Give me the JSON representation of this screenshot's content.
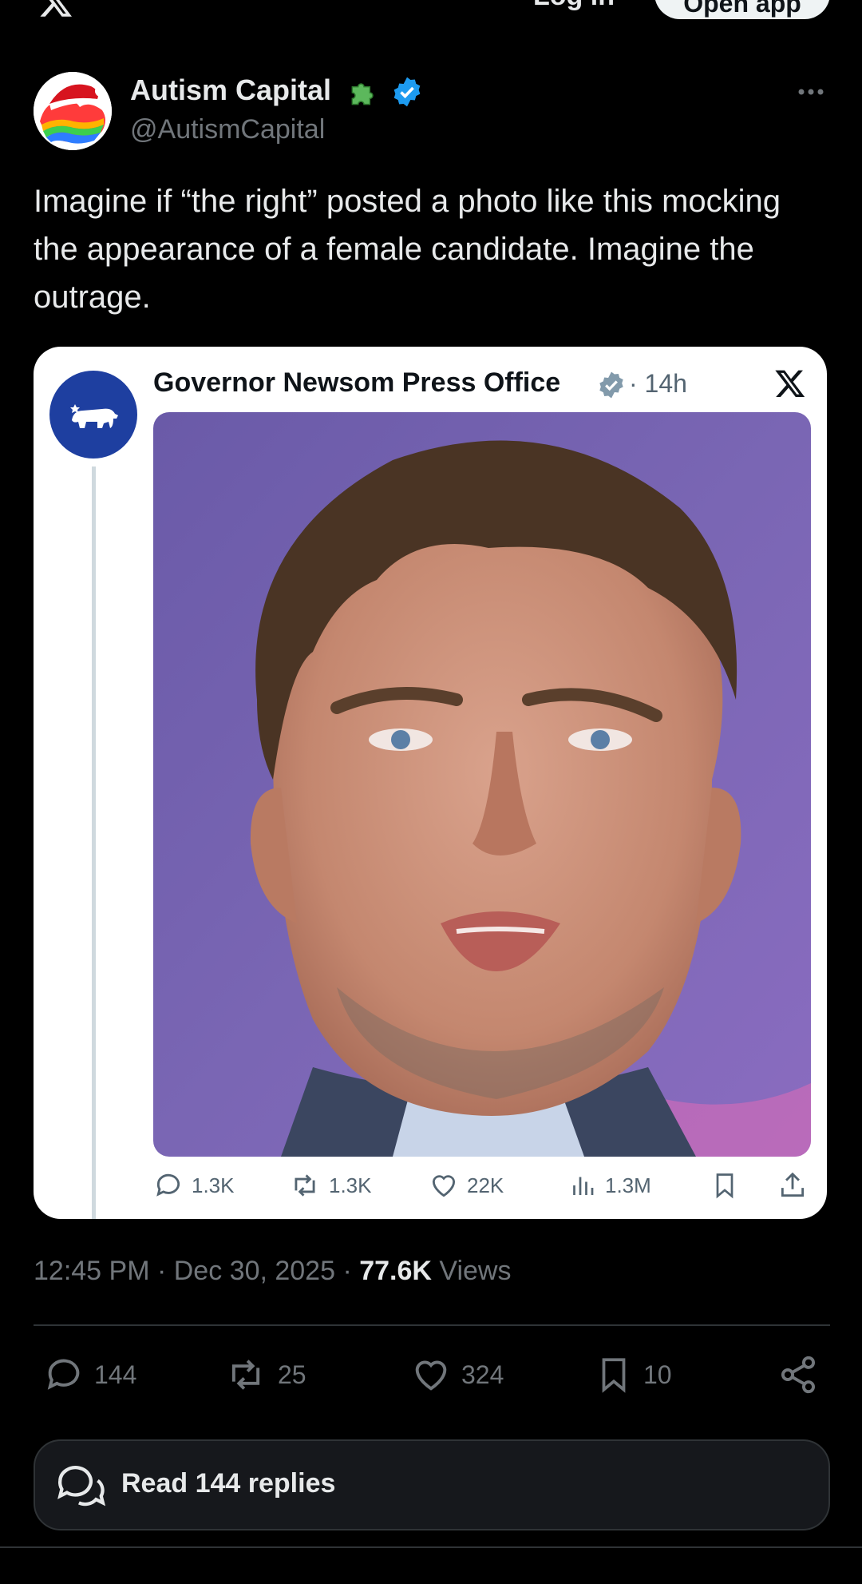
{
  "topbar": {
    "login_label": "Log in",
    "open_app_label": "Open app"
  },
  "post": {
    "author": "Autism Capital",
    "handle": "@AutismCapital",
    "text": "Imagine if “the right” posted a photo like this mocking the appearance of a female candidate. Imagine the outrage.",
    "timestamp": "12:45 PM · Dec 30, 2025 · ",
    "views_count": "77.6K",
    "views_label": " Views"
  },
  "quote": {
    "author": "Governor Newsom Press Office",
    "time": "· 14h",
    "replies": "1.3K",
    "reposts": "1.3K",
    "likes": "22K",
    "views": "1.3M"
  },
  "actions": {
    "replies": "144",
    "reposts": "25",
    "likes": "324",
    "bookmarks": "10"
  },
  "read_replies": {
    "label": "Read 144 replies"
  },
  "colors": {
    "background": "#000000",
    "verified_blue": "#1d9bf0",
    "muted": "#71767b",
    "divider": "#2f3336"
  },
  "icons": [
    "x-logo-icon",
    "puzzle-icon",
    "verified-icon",
    "more-icon",
    "reply-icon",
    "repost-icon",
    "like-icon",
    "views-icon",
    "bookmark-icon",
    "share-icon",
    "chat-bubbles-icon"
  ]
}
